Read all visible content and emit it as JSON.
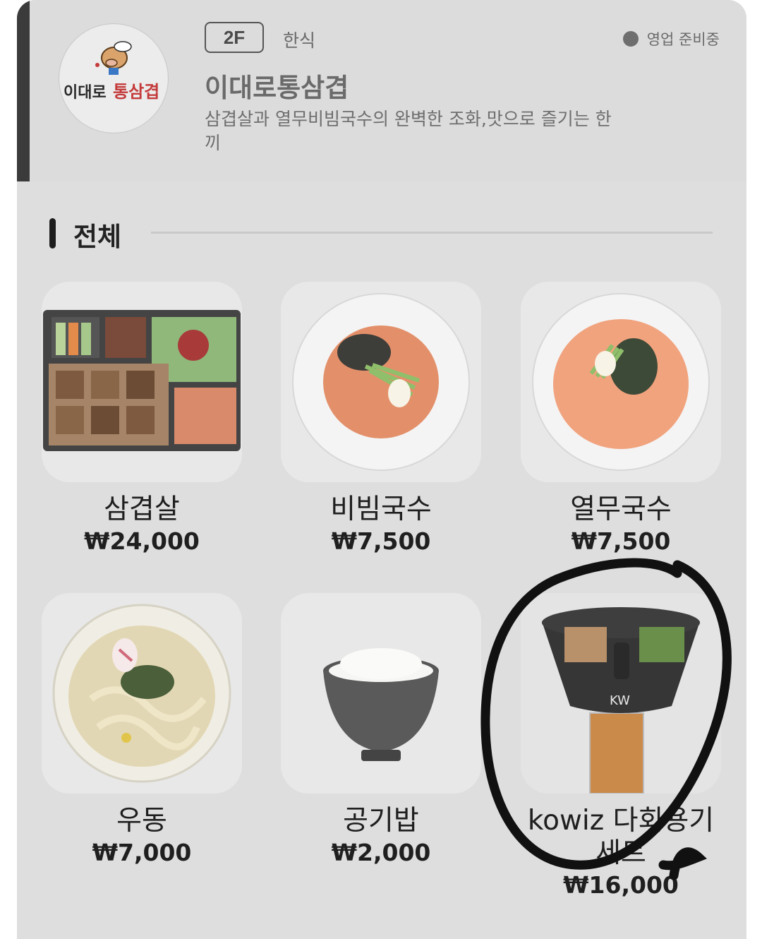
{
  "store": {
    "logo_text": "이대로 통삼겹",
    "floor": "2F",
    "category": "한식",
    "status": "영업 준비중",
    "name": "이대로통삼겹",
    "description": "삼겹살과 열무비빔국수의 완벽한 조화,맛으로 즐기는 한끼"
  },
  "section": {
    "title": "전체"
  },
  "menu": [
    {
      "name": "삼겹살",
      "price": "₩24,000",
      "image": "pork-belly-lunchbox"
    },
    {
      "name": "비빔국수",
      "price": "₩7,500",
      "image": "bibim-noodles"
    },
    {
      "name": "열무국수",
      "price": "₩7,500",
      "image": "yeolmu-noodles"
    },
    {
      "name": "우동",
      "price": "₩7,000",
      "image": "udon"
    },
    {
      "name": "공기밥",
      "price": "₩2,000",
      "image": "rice-bowl"
    },
    {
      "name": "kowiz 다회용기 세트",
      "price": "₩16,000",
      "image": "reusable-container-set"
    }
  ],
  "colors": {
    "accent": "#3b3b3b",
    "card_bg": "#dedede",
    "scribble": "#111111"
  }
}
